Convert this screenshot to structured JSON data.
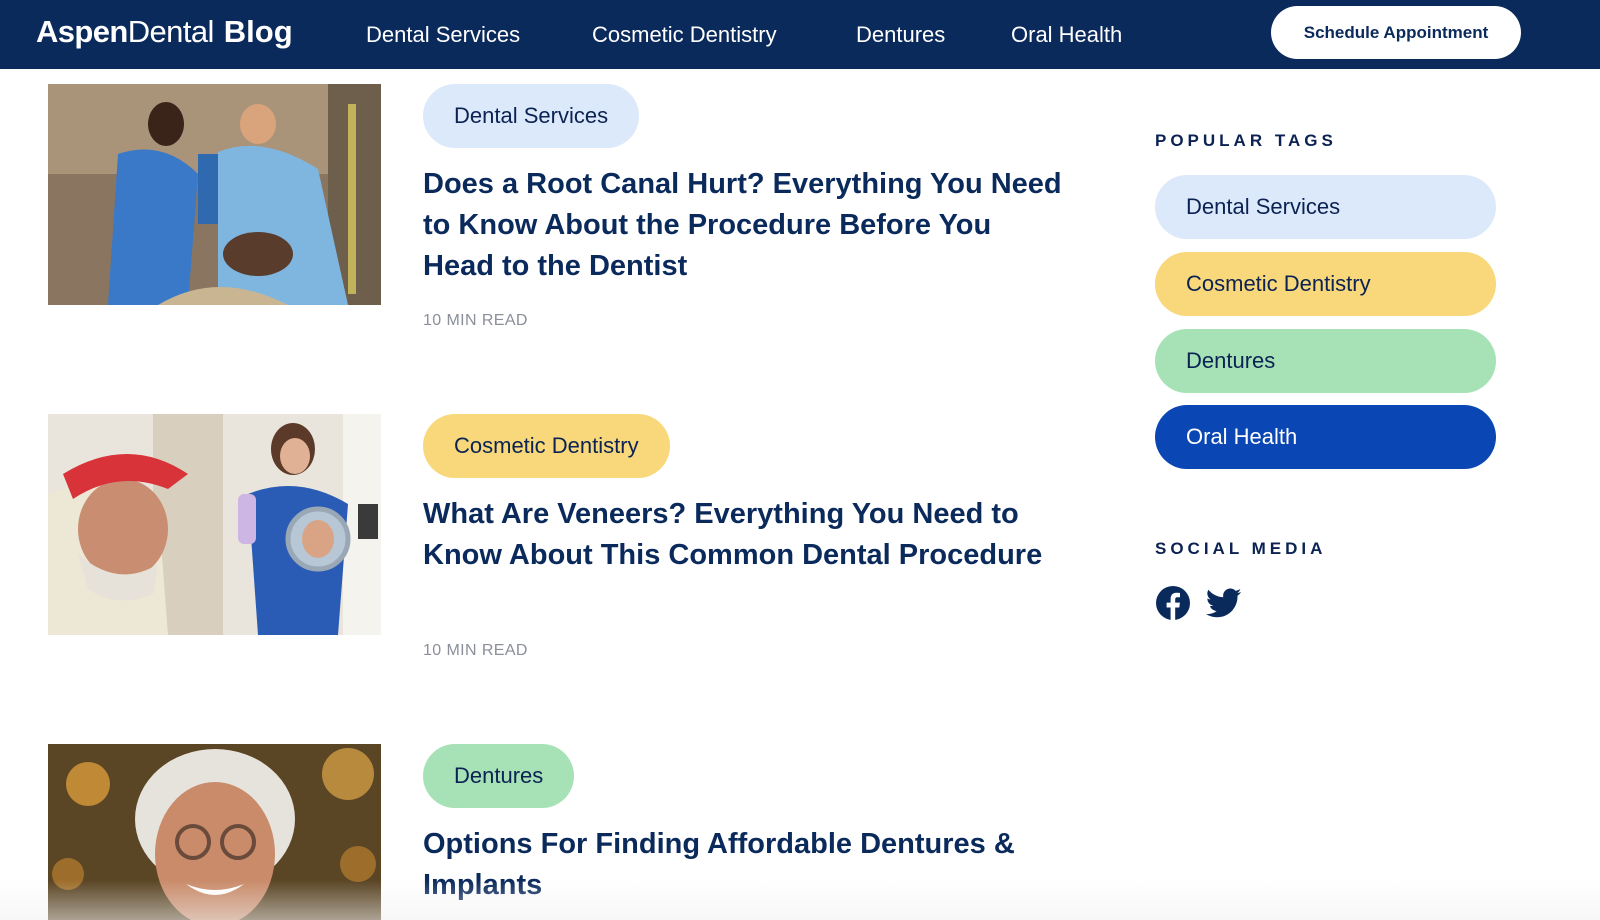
{
  "header": {
    "logo": {
      "part1": "Aspen",
      "part2": "Dental",
      "part3": "Blog"
    },
    "nav": [
      {
        "label": "Dental Services"
      },
      {
        "label": "Cosmetic Dentistry"
      },
      {
        "label": "Dentures"
      },
      {
        "label": "Oral Health"
      }
    ],
    "cta_label": "Schedule Appointment"
  },
  "articles": [
    {
      "tag": "Dental Services",
      "title": "Does a Root Canal Hurt? Everything You Need to Know About the Procedure Before You Head to the Dentist",
      "read_time": "10 MIN READ"
    },
    {
      "tag": "Cosmetic Dentistry",
      "title": "What Are Veneers? Everything You Need to Know About This Common Dental Procedure",
      "read_time": "10 MIN READ"
    },
    {
      "tag": "Dentures",
      "title": "Options For Finding Affordable Dentures & Implants"
    }
  ],
  "sidebar": {
    "popular_tags_heading": "POPULAR TAGS",
    "tags": [
      {
        "label": "Dental Services",
        "color": "#dce9fb"
      },
      {
        "label": "Cosmetic Dentistry",
        "color": "#f8d87a"
      },
      {
        "label": "Dentures",
        "color": "#a6e2b6"
      },
      {
        "label": "Oral Health",
        "color": "#0a46b4"
      }
    ],
    "social_heading": "SOCIAL MEDIA",
    "social_icons": [
      "facebook-icon",
      "twitter-icon"
    ]
  },
  "colors": {
    "header_bg": "#0b2a5c",
    "heading_text": "#0b2a5c",
    "muted_text": "#8a8f99"
  }
}
